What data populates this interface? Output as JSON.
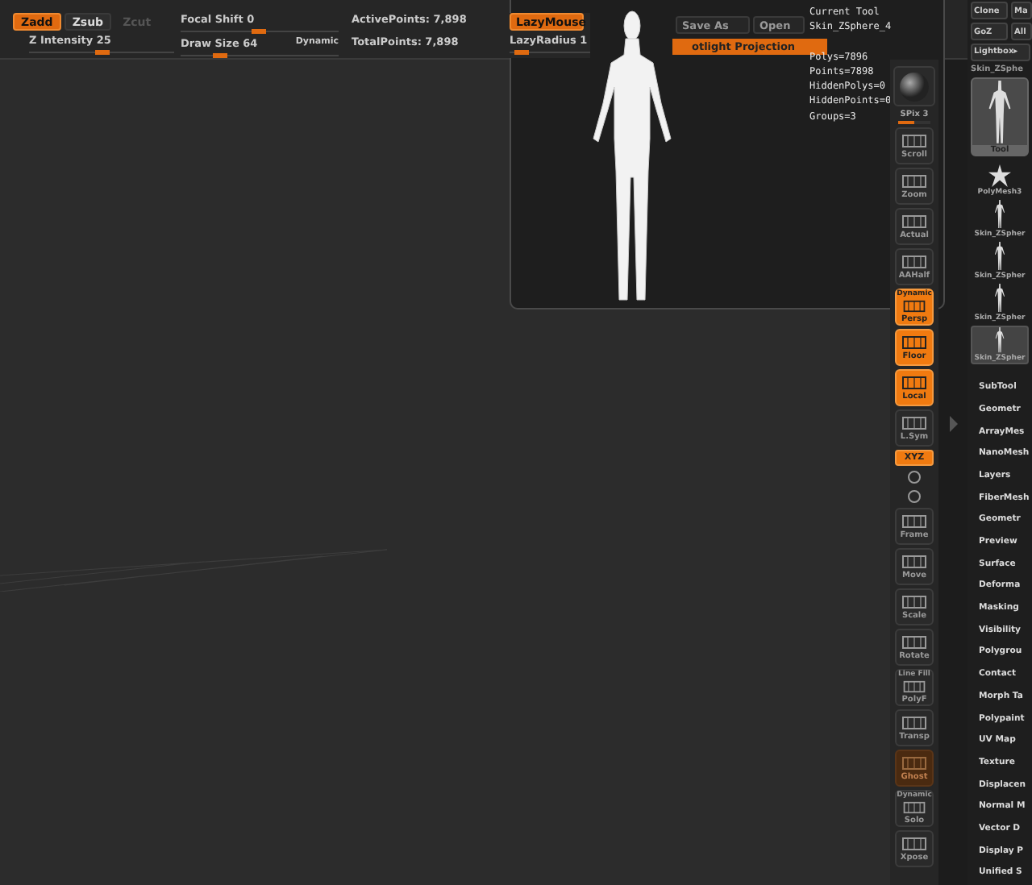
{
  "top_bar": {
    "modes": [
      {
        "label": "Zadd",
        "selected": true,
        "disabled": false
      },
      {
        "label": "Zsub",
        "selected": false,
        "disabled": false
      },
      {
        "label": "Zcut",
        "selected": false,
        "disabled": true
      }
    ],
    "z_intensity": {
      "label": "Z Intensity 25",
      "level": 0.45
    },
    "focal_shift": {
      "label": "Focal Shift 0",
      "level": 0.45
    },
    "draw_size": {
      "label": "Draw Size 64",
      "level": 0.2,
      "tag": "Dynamic"
    },
    "stats": [
      "ActivePoints: 7,898",
      "TotalPoints: 7,898"
    ],
    "lazy_mouse": {
      "label": "LazyMouse",
      "on": true
    },
    "lazy_radius": {
      "label": "LazyRadius 1",
      "level": 0.05
    }
  },
  "tool_popup": {
    "buttons": [
      "Save As",
      "Open"
    ],
    "spotlight": {
      "label": "otlight Projection",
      "on": true
    },
    "current_tool": [
      "Current Tool",
      "Skin_ZSphere_4"
    ],
    "stats": [
      "Polys=7896",
      "Points=7898",
      "HiddenPolys=0",
      "HiddenPoints=0",
      "Groups=3"
    ]
  },
  "shelf": [
    {
      "kind": "sphere"
    },
    {
      "kind": "slider",
      "label": "SPix 3",
      "level": 0.5
    },
    {
      "kind": "button",
      "label": "Scroll",
      "on": false,
      "dimmed": false
    },
    {
      "kind": "button",
      "label": "Zoom",
      "on": false,
      "dimmed": false
    },
    {
      "kind": "button",
      "label": "Actual",
      "on": false,
      "dimmed": false
    },
    {
      "kind": "button",
      "label": "AAHalf",
      "on": false,
      "dimmed": false
    },
    {
      "kind": "button",
      "label": "Persp",
      "sublabel": "Dynamic",
      "on": true,
      "dimmed": false
    },
    {
      "kind": "button",
      "label": "Floor",
      "on": true,
      "dimmed": false
    },
    {
      "kind": "button",
      "label": "Local",
      "on": true,
      "dimmed": false
    },
    {
      "kind": "button",
      "label": "L.Sym",
      "on": false,
      "dimmed": false
    },
    {
      "kind": "toggle",
      "label": "XYZ",
      "on": true
    },
    {
      "kind": "mini"
    },
    {
      "kind": "mini"
    },
    {
      "kind": "button",
      "label": "Frame",
      "on": false,
      "dimmed": false
    },
    {
      "kind": "button",
      "label": "Move",
      "on": false,
      "dimmed": false
    },
    {
      "kind": "button",
      "label": "Scale",
      "on": false,
      "dimmed": false
    },
    {
      "kind": "button",
      "label": "Rotate",
      "on": false,
      "dimmed": false
    },
    {
      "kind": "button",
      "label": "PolyF",
      "sublabel": "Line Fill",
      "on": false,
      "dimmed": false
    },
    {
      "kind": "button",
      "label": "Transp",
      "on": false,
      "dimmed": false
    },
    {
      "kind": "button",
      "label": "Ghost",
      "on": false,
      "dimmed": true
    },
    {
      "kind": "button",
      "label": "Solo",
      "sublabel": "Dynamic",
      "on": false,
      "dimmed": false
    },
    {
      "kind": "button",
      "label": "Xpose",
      "on": false,
      "dimmed": false
    }
  ],
  "tool_panel": {
    "buttons": [
      "Clone",
      "Ma",
      "GoZ",
      "All"
    ],
    "lightbox": "Lightbox▸",
    "current": "Skin_ZSphe",
    "thumbnail_label": "Tool",
    "tools": [
      {
        "kind": "star",
        "label": "PolyMesh3",
        "selected": false
      },
      {
        "kind": "figure",
        "label": "Skin_ZSpher",
        "selected": false
      },
      {
        "kind": "figure",
        "label": "Skin_ZSpher",
        "selected": false
      },
      {
        "kind": "figure",
        "label": "Skin_ZSpher",
        "selected": false
      },
      {
        "kind": "figure",
        "label": "Skin_ZSpher",
        "selected": true
      }
    ],
    "menus": [
      "SubTool",
      "Geometr",
      "ArrayMes",
      "NanoMesh",
      "Layers",
      "FiberMesh",
      "Geometr",
      "Preview",
      "Surface",
      "Deforma",
      "Masking",
      "Visibility",
      "Polygrou",
      "Contact",
      "Morph Ta",
      "Polypaint",
      "UV Map",
      "Texture",
      "Displacen",
      "Normal M",
      "Vector D",
      "Display P",
      "Unified S"
    ]
  }
}
